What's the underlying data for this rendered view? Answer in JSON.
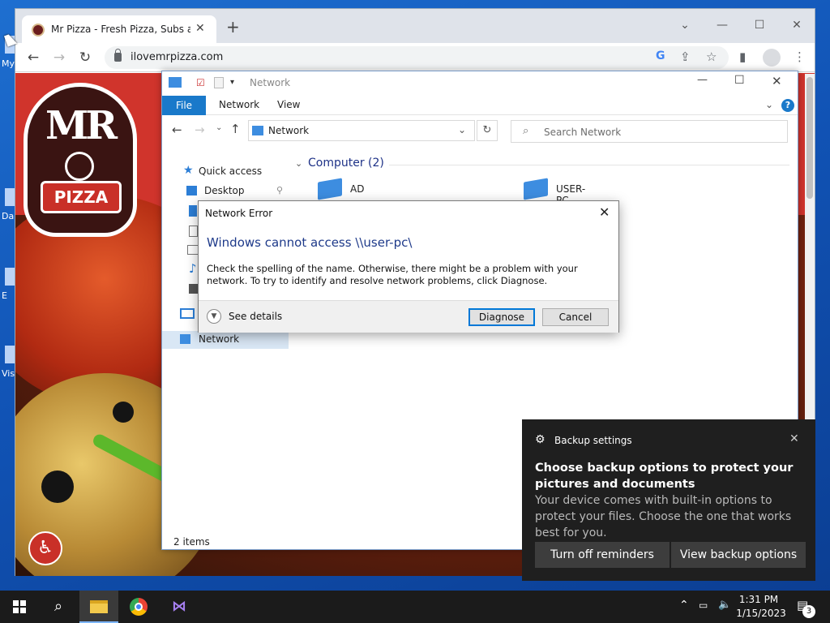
{
  "desktop": {
    "icons": [
      "My",
      "Da",
      "E",
      "Vis"
    ]
  },
  "browser": {
    "tab_title": "Mr Pizza - Fresh Pizza, Subs and",
    "new_tab_symbol": "+",
    "url": "ilovemrpizza.com"
  },
  "site": {
    "logo_mr": "MR",
    "logo_pizza": "PIZZA",
    "accessibility_symbol": "♿"
  },
  "explorer": {
    "title": "Network",
    "ribbon": {
      "file": "File",
      "network": "Network",
      "view": "View",
      "help": "?"
    },
    "address": "Network",
    "search_placeholder": "Search Network",
    "nav_pane": {
      "quick_access": "Quick access",
      "desktop": "Desktop",
      "network": "Network"
    },
    "group_header": "Computer (2)",
    "computers": [
      "AD",
      "USER-PC"
    ],
    "status": "2 items"
  },
  "dialog": {
    "title": "Network Error",
    "heading": "Windows cannot access \\\\user-pc\\",
    "body": "Check the spelling of the name. Otherwise, there might be a problem with your network. To try to identify and resolve network problems, click Diagnose.",
    "see_details": "See details",
    "diagnose": "Diagnose",
    "cancel": "Cancel"
  },
  "toast": {
    "app": "Backup settings",
    "title": "Choose backup options to protect your pictures and documents",
    "body": "Your device comes with built-in options to protect your files. Choose the one that works best for you.",
    "turn_off": "Turn off reminders",
    "view_options": "View backup options"
  },
  "taskbar": {
    "time": "1:31 PM",
    "date": "1/15/2023",
    "notification_count": "3"
  },
  "colors": {
    "explorer_accent": "#1979ca",
    "dialog_heading": "#1e3a8a",
    "toast_bg": "#1f1f1f",
    "site_red": "#d0342c"
  }
}
